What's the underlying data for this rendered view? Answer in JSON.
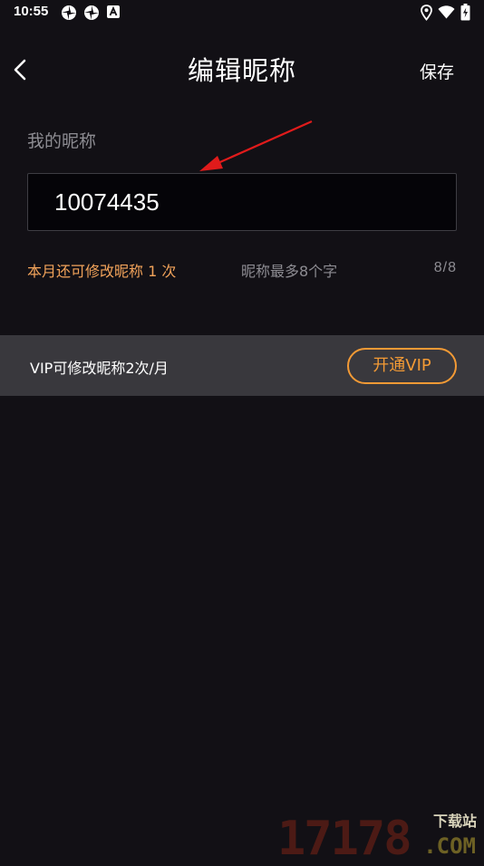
{
  "status_bar": {
    "time": "10:55",
    "left_icons": [
      "aperture-icon",
      "aperture-icon",
      "a-badge-icon"
    ],
    "right_icons": [
      "location-icon",
      "wifi-icon",
      "battery-icon"
    ]
  },
  "nav": {
    "back_icon": "chevron-left-icon",
    "title": "编辑昵称",
    "save_label": "保存"
  },
  "form": {
    "label": "我的昵称",
    "nickname_value": "10074435",
    "remaining_changes": "本月还可修改昵称 1 次",
    "rule": "昵称最多8个字",
    "char_count": "8/8"
  },
  "vip": {
    "text": "VIP可修改昵称2次/月",
    "button_label": "开通VIP"
  },
  "watermark": {
    "number": "17178",
    "site": "下载站",
    "domain": ".COM"
  },
  "colors": {
    "background": "#121015",
    "accent_orange": "#f39a35",
    "hint_orange": "#f2a35a",
    "annotation_red": "#e01b1b",
    "vip_bar": "#39383d"
  }
}
